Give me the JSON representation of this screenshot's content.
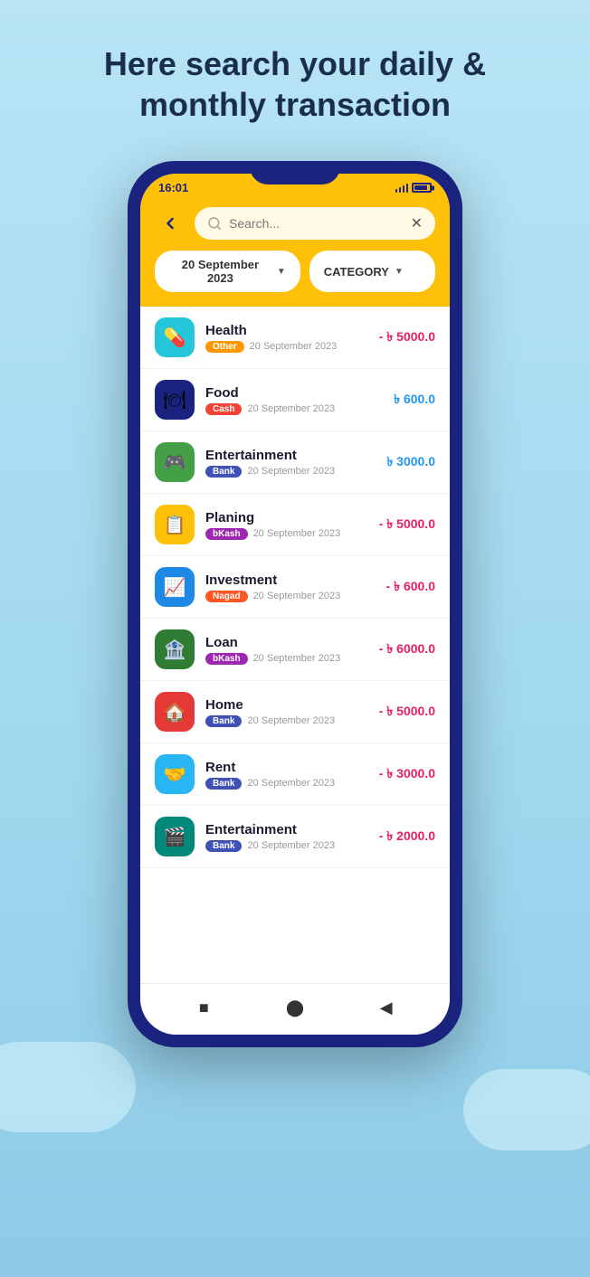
{
  "page": {
    "title": "Here search your daily & monthly transaction",
    "background_color": "#b8e4f5"
  },
  "phone": {
    "status_bar": {
      "time": "16:01"
    },
    "header": {
      "search_placeholder": "Search...",
      "date_filter": "20 September 2023",
      "category_filter": "CATEGORY"
    },
    "transactions": [
      {
        "id": 1,
        "name": "Health",
        "tag": "Other",
        "tag_class": "tag-other",
        "date": "20 September 2023",
        "amount": "- ৳ 5000.0",
        "amount_class": "amount-negative",
        "icon_emoji": "💊",
        "icon_class": "icon-teal"
      },
      {
        "id": 2,
        "name": "Food",
        "tag": "Cash",
        "tag_class": "tag-cash",
        "date": "20 September 2023",
        "amount": "৳ 600.0",
        "amount_class": "amount-positive",
        "icon_emoji": "🍽",
        "icon_class": "icon-navy"
      },
      {
        "id": 3,
        "name": "Entertainment",
        "tag": "Bank",
        "tag_class": "tag-bank",
        "date": "20 September 2023",
        "amount": "৳ 3000.0",
        "amount_class": "amount-positive",
        "icon_emoji": "🎮",
        "icon_class": "icon-green"
      },
      {
        "id": 4,
        "name": "Planing",
        "tag": "bKash",
        "tag_class": "tag-bkash",
        "date": "20 September 2023",
        "amount": "- ৳ 5000.0",
        "amount_class": "amount-negative",
        "icon_emoji": "📋",
        "icon_class": "icon-yellow"
      },
      {
        "id": 5,
        "name": "Investment",
        "tag": "Nagad",
        "tag_class": "tag-nagad",
        "date": "20 September 2023",
        "amount": "- ৳ 600.0",
        "amount_class": "amount-negative",
        "icon_emoji": "📈",
        "icon_class": "icon-blue"
      },
      {
        "id": 6,
        "name": "Loan",
        "tag": "bKash",
        "tag_class": "tag-bkash",
        "date": "20 September 2023",
        "amount": "- ৳ 6000.0",
        "amount_class": "amount-negative",
        "icon_emoji": "🏦",
        "icon_class": "icon-green2"
      },
      {
        "id": 7,
        "name": "Home",
        "tag": "Bank",
        "tag_class": "tag-bank",
        "date": "20 September 2023",
        "amount": "- ৳ 5000.0",
        "amount_class": "amount-negative",
        "icon_emoji": "🏠",
        "icon_class": "icon-red"
      },
      {
        "id": 8,
        "name": "Rent",
        "tag": "Bank",
        "tag_class": "tag-bank",
        "date": "20 September 2023",
        "amount": "- ৳ 3000.0",
        "amount_class": "amount-negative",
        "icon_emoji": "🤝",
        "icon_class": "icon-lightblue"
      },
      {
        "id": 9,
        "name": "Entertainment",
        "tag": "Bank",
        "tag_class": "tag-bank",
        "date": "20 September 2023",
        "amount": "- ৳ 2000.0",
        "amount_class": "amount-negative",
        "icon_emoji": "🎬",
        "icon_class": "icon-green3"
      }
    ],
    "bottom_nav": {
      "stop_icon": "■",
      "home_icon": "⬤",
      "back_icon": "◀"
    }
  }
}
